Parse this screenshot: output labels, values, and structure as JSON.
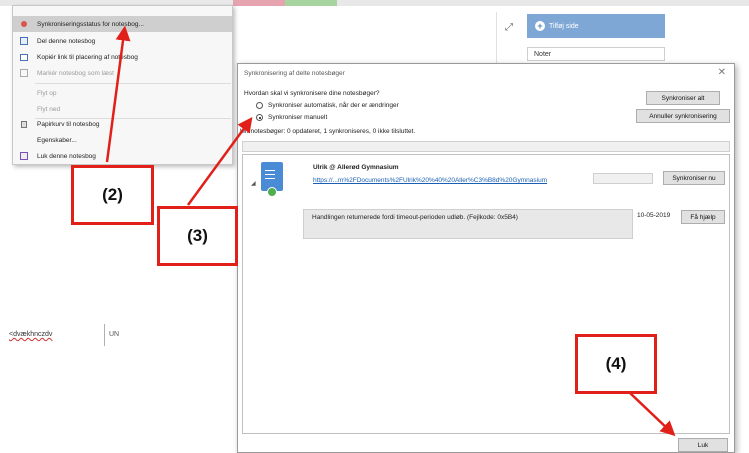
{
  "background": {
    "add_page_label": "Tilføj side",
    "note_item": "Noter",
    "doc_text": "<dvækhnczdv",
    "doc_column_text": "UN"
  },
  "menu": {
    "items": [
      {
        "label": "Synkroniseringsstatus for notesbog...",
        "enabled": true,
        "highlighted": true,
        "icon": "sync-status-icon"
      },
      {
        "label": "Del denne notesbog",
        "enabled": true,
        "icon": "share-icon"
      },
      {
        "label": "Kopiér link til placering af notesbog",
        "enabled": true,
        "icon": "copy-link-icon"
      },
      {
        "label": "Markér notesbog som læst",
        "enabled": false,
        "icon": "mark-read-icon"
      },
      {
        "label": "Flyt op",
        "enabled": false,
        "icon": ""
      },
      {
        "label": "Flyt ned",
        "enabled": false,
        "icon": ""
      },
      {
        "label": "Papirkurv til notesbog",
        "enabled": true,
        "icon": "recycle-bin-icon"
      },
      {
        "label": "Egenskaber...",
        "enabled": true,
        "icon": ""
      },
      {
        "label": "Luk denne notesbog",
        "enabled": true,
        "icon": "close-notebook-icon"
      }
    ]
  },
  "dialog": {
    "title": "Synkronisering af delte notesbøger",
    "question": "Hvordan skal vi synkronisere dine notesbøger?",
    "option_auto": "Synkroniser automatisk, når der er ændringer",
    "option_manual": "Synkroniser manuelt",
    "selected": "manual",
    "summary": "lemnotesbøger: 0 opdateret, 1 synkroniseres, 0 ikke tilsluttet.",
    "sync_all": "Synkroniser alt",
    "cancel_sync": "Annuller synkronisering",
    "notebook": {
      "owner": "Ulrik @ Allerød Gymnasium",
      "link": "https://...m%2FDocuments%2FUlrik%20%40%20Aller%C3%B8d%20Gymnasium",
      "sync_now": "Synkroniser nu",
      "error": "Handlingen returnerede fordi timeout-perioden udløb. (Fejlkode: 0x5B4)",
      "date": "10-05-2019",
      "help": "Få hjælp"
    },
    "close": "Luk"
  },
  "annotations": {
    "step2": "(2)",
    "step3": "(3)",
    "step4": "(4)",
    "color": "#e2201a"
  }
}
